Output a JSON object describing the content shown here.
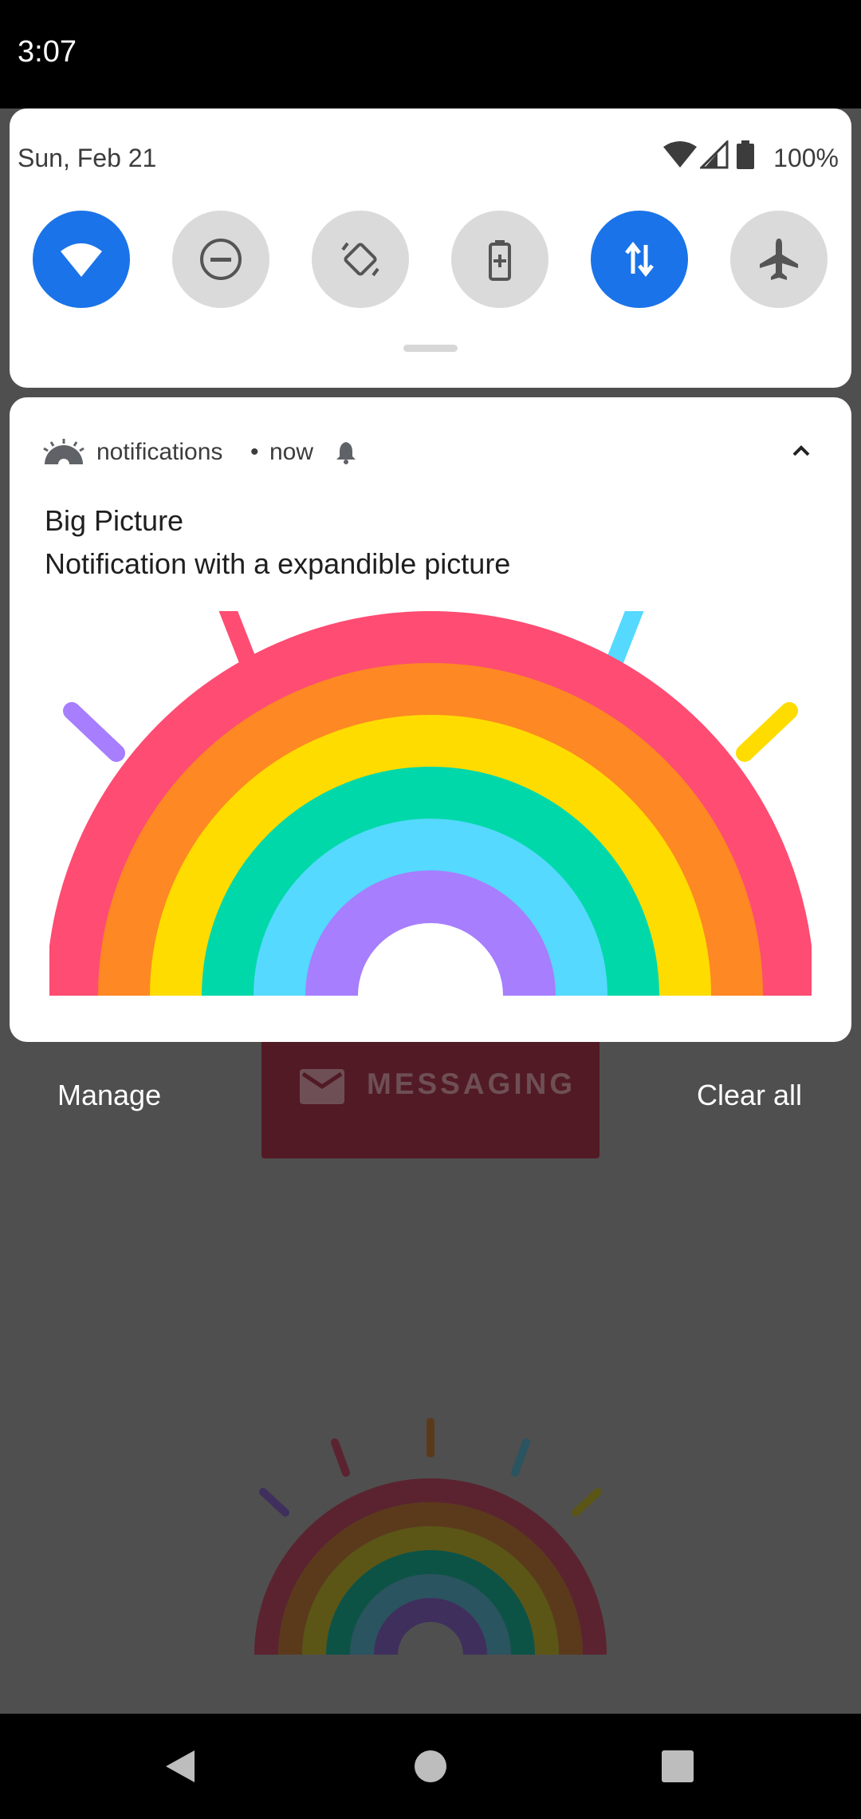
{
  "status_bar": {
    "time": "3:07"
  },
  "quick_settings": {
    "date": "Sun, Feb 21",
    "battery_percent": "100%",
    "tiles": [
      {
        "name": "wifi-icon",
        "active": true
      },
      {
        "name": "do-not-disturb-icon",
        "active": false
      },
      {
        "name": "auto-rotate-icon",
        "active": false
      },
      {
        "name": "battery-saver-icon",
        "active": false
      },
      {
        "name": "mobile-data-icon",
        "active": true
      },
      {
        "name": "airplane-mode-icon",
        "active": false
      }
    ]
  },
  "notification": {
    "app_name": "notifications",
    "separator": "•",
    "time": "now",
    "title": "Big Picture",
    "text": "Notification with a expandible picture"
  },
  "shade_actions": {
    "manage_label": "Manage",
    "clear_all_label": "Clear all"
  },
  "background_app": {
    "messaging_label": "MESSAGING"
  },
  "colors": {
    "accent": "#1a73e8",
    "tile_off": "#dadada",
    "rainbow": [
      "#fe4c72",
      "#fe8823",
      "#ffdc00",
      "#00d8aa",
      "#55d9fe",
      "#a67efe"
    ]
  }
}
